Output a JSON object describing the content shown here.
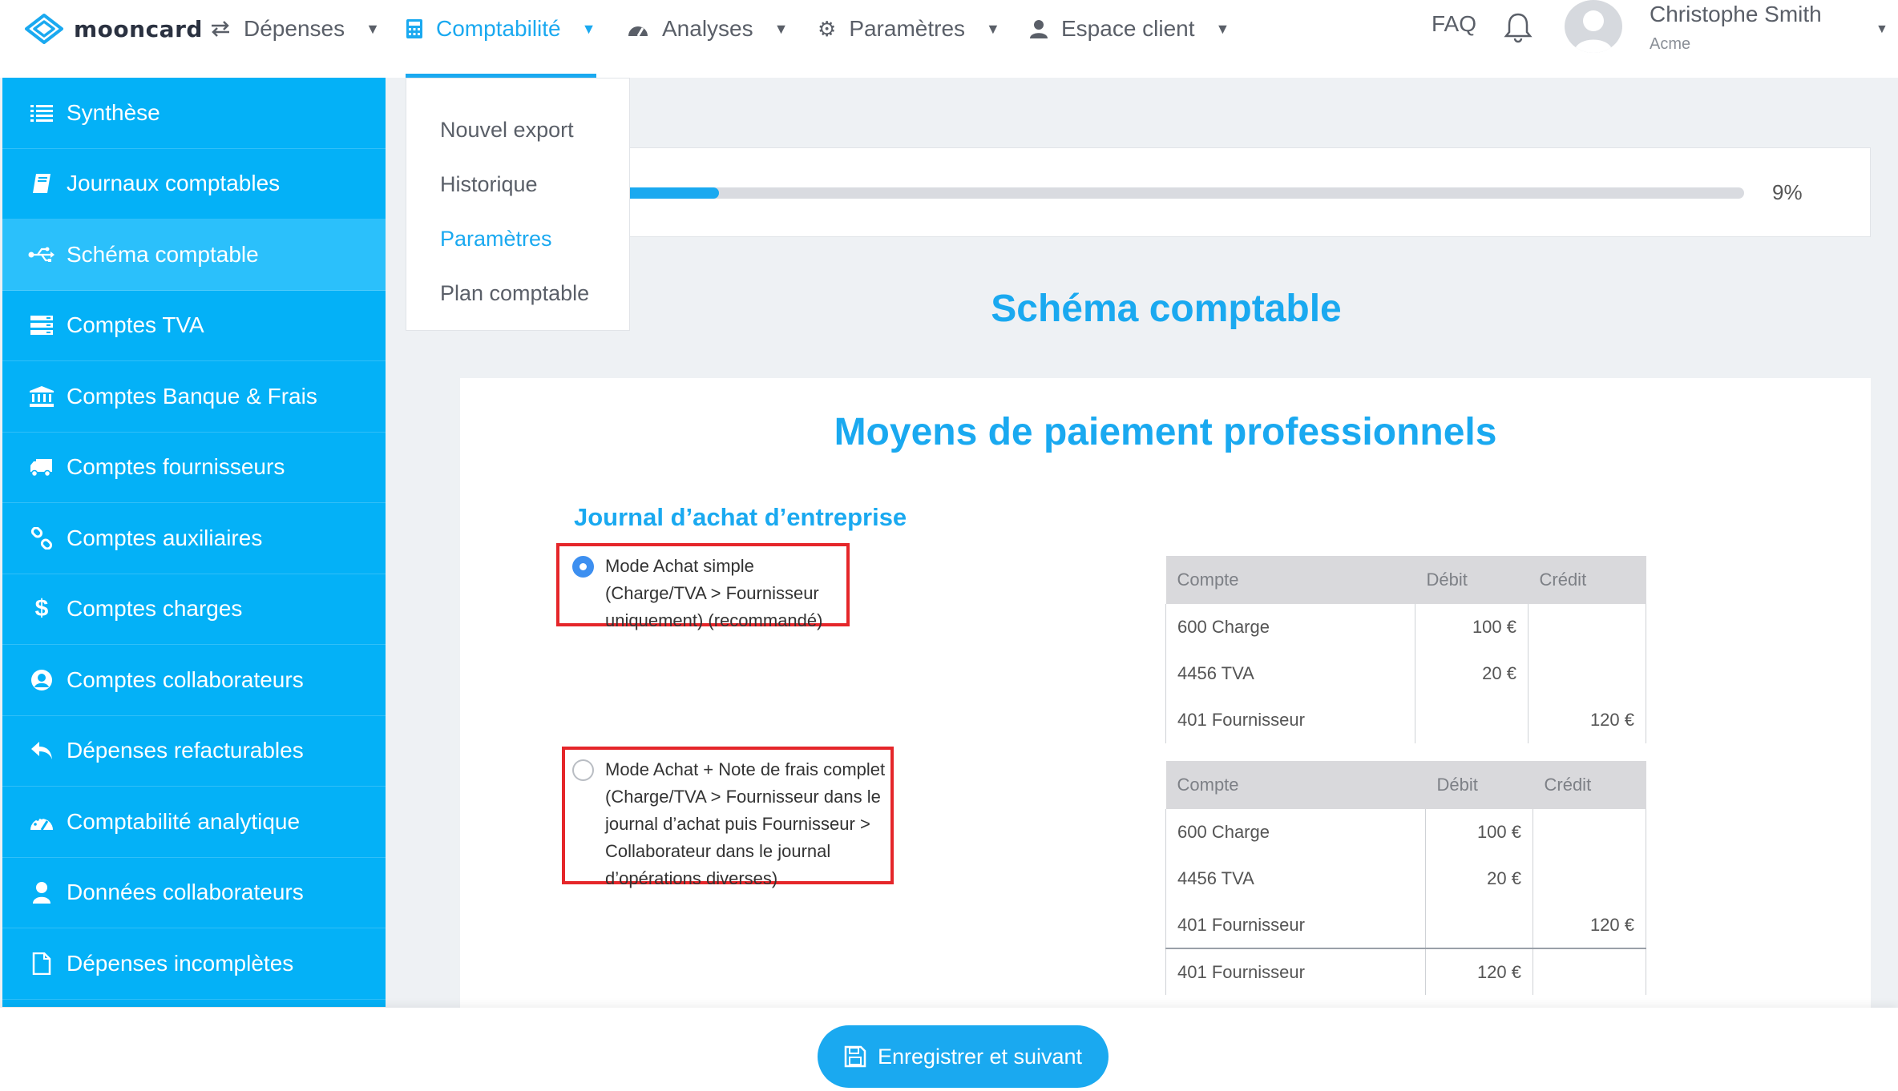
{
  "brand": {
    "name": "mooncard",
    "accent": "#1aa9f0",
    "sidebar_bg": "#04b1f7",
    "highlight": "#e5262a"
  },
  "nav": {
    "items": [
      {
        "label": "Dépenses",
        "icon": "transfer-arrows-icon"
      },
      {
        "label": "Comptabilité",
        "icon": "calculator-icon",
        "active": true
      },
      {
        "label": "Analyses",
        "icon": "dashboard-gauge-icon"
      },
      {
        "label": "Paramètres",
        "icon": "gear-icon"
      },
      {
        "label": "Espace client",
        "icon": "user-icon"
      }
    ],
    "faq": "FAQ",
    "user": {
      "name": "Christophe Smith",
      "company": "Acme"
    }
  },
  "dropdown": {
    "items": [
      {
        "label": "Nouvel export"
      },
      {
        "label": "Historique"
      },
      {
        "label": "Paramètres",
        "active": true
      },
      {
        "label": "Plan comptable"
      }
    ]
  },
  "sidebar": {
    "items": [
      {
        "label": "Synthèse",
        "icon": "list-icon"
      },
      {
        "label": "Journaux comptables",
        "icon": "book-icon"
      },
      {
        "label": "Schéma comptable",
        "icon": "usb-schema-icon",
        "active": true
      },
      {
        "label": "Comptes TVA",
        "icon": "server-stack-icon"
      },
      {
        "label": "Comptes Banque & Frais",
        "icon": "bank-icon"
      },
      {
        "label": "Comptes fournisseurs",
        "icon": "truck-icon"
      },
      {
        "label": "Comptes auxiliaires",
        "icon": "link-icon"
      },
      {
        "label": "Comptes charges",
        "icon": "dollar-icon"
      },
      {
        "label": "Comptes collaborateurs",
        "icon": "user-circle-icon"
      },
      {
        "label": "Dépenses refacturables",
        "icon": "reply-arrow-icon"
      },
      {
        "label": "Comptabilité analytique",
        "icon": "gauge-icon"
      },
      {
        "label": "Données collaborateurs",
        "icon": "person-icon"
      },
      {
        "label": "Dépenses incomplètes",
        "icon": "file-icon"
      }
    ]
  },
  "progress": {
    "percent_label": "9%",
    "value": 0.09
  },
  "main": {
    "page_title": "Schéma comptable",
    "section_title": "Moyens de paiement professionnels",
    "journal_title": "Journal d’achat d’entreprise",
    "options": [
      {
        "label": "Mode Achat simple (Charge/TVA > Fournisseur uniquement) (recommandé)",
        "checked": true
      },
      {
        "label": "Mode Achat + Note de frais complet (Charge/TVA > Fournisseur dans le journal d’achat puis Fournisseur > Collaborateur dans le journal d’opérations diverses)",
        "checked": false
      }
    ],
    "table1": {
      "headers": [
        "Compte",
        "Débit",
        "Crédit"
      ],
      "rows": [
        [
          "600 Charge",
          "100 €",
          ""
        ],
        [
          "4456 TVA",
          "20 €",
          ""
        ],
        [
          "401 Fournisseur",
          "",
          "120 €"
        ]
      ]
    },
    "table2": {
      "headers": [
        "Compte",
        "Débit",
        "Crédit"
      ],
      "rows": [
        [
          "600 Charge",
          "100 €",
          ""
        ],
        [
          "4456 TVA",
          "20 €",
          ""
        ],
        [
          "401 Fournisseur",
          "",
          "120 €"
        ],
        [
          "401 Fournisseur",
          "120 €",
          ""
        ]
      ]
    }
  },
  "footer": {
    "save_label": "Enregistrer et suivant"
  }
}
